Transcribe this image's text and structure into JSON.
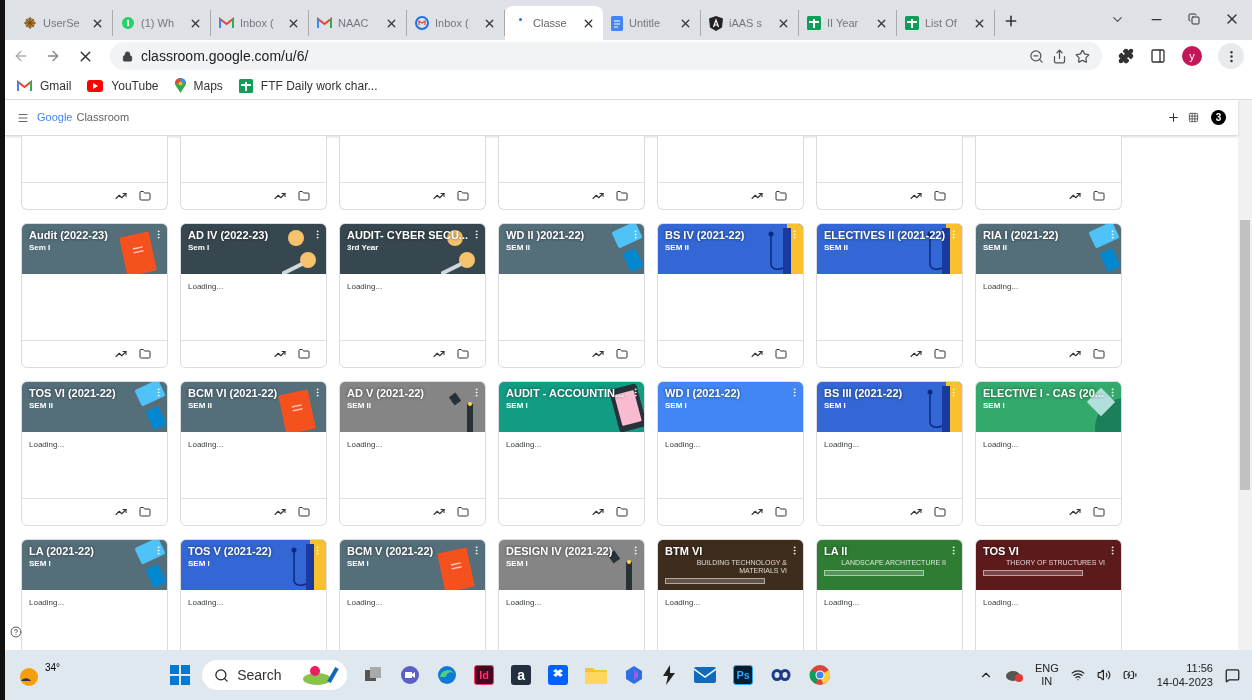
{
  "tabs": [
    {
      "label": "UserSe",
      "selected": false,
      "kind": "bug"
    },
    {
      "label": "(1) Wh",
      "selected": false,
      "kind": "whatsapp"
    },
    {
      "label": "Inbox (",
      "selected": false,
      "kind": "gmail"
    },
    {
      "label": "NAAC",
      "selected": false,
      "kind": "gmail"
    },
    {
      "label": "Inbox (",
      "selected": false,
      "kind": "ring"
    },
    {
      "label": "Classe",
      "selected": true,
      "kind": "spinner"
    },
    {
      "label": "Untitle",
      "selected": false,
      "kind": "docs"
    },
    {
      "label": "iAAS s",
      "selected": false,
      "kind": "shield"
    },
    {
      "label": "II Year",
      "selected": false,
      "kind": "sheets"
    },
    {
      "label": "List Of",
      "selected": false,
      "kind": "sheets"
    }
  ],
  "address": {
    "url": "classroom.google.com/u/6/",
    "avatar": "y"
  },
  "bookmarks": [
    {
      "label": "Gmail",
      "kind": "gmail"
    },
    {
      "label": "YouTube",
      "kind": "youtube"
    },
    {
      "label": "Maps",
      "kind": "maps"
    },
    {
      "label": "FTF Daily work char...",
      "kind": "sheets"
    }
  ],
  "app": {
    "logo": "Google",
    "name": "Classroom",
    "badge": "3"
  },
  "rows": [
    [
      {
        "kind": "cut"
      },
      {
        "kind": "cut"
      },
      {
        "kind": "cut"
      },
      {
        "kind": "cut"
      },
      {
        "kind": "cut"
      },
      {
        "kind": "cut"
      },
      {
        "kind": "cut"
      }
    ],
    [
      {
        "kind": "book",
        "title": "Audit (2022-23)",
        "subtitle": "Sem I",
        "color": "#546e7a"
      },
      {
        "kind": "coins",
        "title": "AD IV (2022-23)",
        "subtitle": "Sem I",
        "color": "#37474f",
        "status": "Loading..."
      },
      {
        "kind": "coins",
        "title": "AUDIT- CYBER SECU...",
        "subtitle": "3rd Year",
        "color": "#37474f",
        "status": "Loading..."
      },
      {
        "kind": "tablet",
        "title": "WD II )2021-22)",
        "subtitle": "SEM II",
        "color": "#546e7a"
      },
      {
        "kind": "headphones",
        "title": "BS IV (2021-22)",
        "subtitle": "SEM II",
        "color": "#3367d6"
      },
      {
        "kind": "headphones",
        "title": "ELECTIVES II (2021-22)",
        "subtitle": "SEM II",
        "color": "#3367d6"
      },
      {
        "kind": "tablet",
        "title": "RIA I (2021-22)",
        "subtitle": "SEM II",
        "color": "#546e7a",
        "status": "Loading..."
      }
    ],
    [
      {
        "kind": "tablet",
        "title": "TOS VI (2021-22)",
        "subtitle": "SEM II",
        "color": "#546e7a",
        "status": "Loading..."
      },
      {
        "kind": "book",
        "title": "BCM VI (2021-22)",
        "subtitle": "SEM II",
        "color": "#546e7a",
        "status": "Loading..."
      },
      {
        "kind": "pen",
        "title": "AD V (2021-22)",
        "subtitle": "SEM II",
        "color": "#858585",
        "status": "Loading..."
      },
      {
        "kind": "clipboard",
        "title": "AUDIT - ACCOUNTIN...",
        "subtitle": "SEM I",
        "color": "#129c84",
        "status": "Loading..."
      },
      {
        "kind": "plain",
        "title": "WD I (2021-22)",
        "subtitle": "SEM I",
        "color": "#4285f4",
        "status": "Loading..."
      },
      {
        "kind": "headphones",
        "title": "BS III (2021-22)",
        "subtitle": "SEM I",
        "color": "#3367d6",
        "status": "Loading..."
      },
      {
        "kind": "leaf",
        "title": "ELECTIVE I - CAS (20...",
        "subtitle": "SEM I",
        "color": "#33a96b",
        "status": "Loading..."
      }
    ],
    [
      {
        "kind": "tablet",
        "title": "LA (2021-22)",
        "subtitle": "SEM I",
        "color": "#546e7a",
        "status": "Loading..."
      },
      {
        "kind": "headphones",
        "title": "TOS V (2021-22)",
        "subtitle": "SEM I",
        "color": "#3367d6",
        "status": "Loading..."
      },
      {
        "kind": "book",
        "title": "BCM V (2021-22)",
        "subtitle": "SEM I",
        "color": "#546e7a",
        "status": "Loading..."
      },
      {
        "kind": "pen",
        "title": "DESIGN IV (2021-22)",
        "subtitle": "SEM I",
        "color": "#858585",
        "status": "Loading..."
      },
      {
        "kind": "banner",
        "title": "BTM VI",
        "banner": "BUILDING TECHNOLOGY & MATERIALS VI",
        "color": "#3e2c1c",
        "status": "Loading..."
      },
      {
        "kind": "banner",
        "title": "LA II",
        "banner": "LANDSCAPE ARCHITECTURE II",
        "color": "#2e7d32",
        "status": "Loading..."
      },
      {
        "kind": "banner",
        "title": "TOS VI",
        "banner": "THEORY OF STRUCTURES VI",
        "color": "#5c1a1a",
        "status": "Loading..."
      }
    ]
  ],
  "taskbar": {
    "temperature": "34°",
    "search": "Search",
    "apps": [
      {
        "kind": "tiles"
      },
      {
        "kind": "meet"
      },
      {
        "kind": "edge"
      },
      {
        "kind": "indesign",
        "glyph": "Id"
      },
      {
        "kind": "amazon",
        "glyph": "a"
      },
      {
        "kind": "dropbox"
      },
      {
        "kind": "folder"
      },
      {
        "kind": "copilot"
      },
      {
        "kind": "bolt"
      },
      {
        "kind": "mail"
      },
      {
        "kind": "photoshop",
        "glyph": "Ps"
      },
      {
        "kind": "link"
      },
      {
        "kind": "chrome"
      }
    ],
    "lang": "ENG",
    "region": "IN",
    "time": "11:56",
    "date": "14-04-2023"
  }
}
